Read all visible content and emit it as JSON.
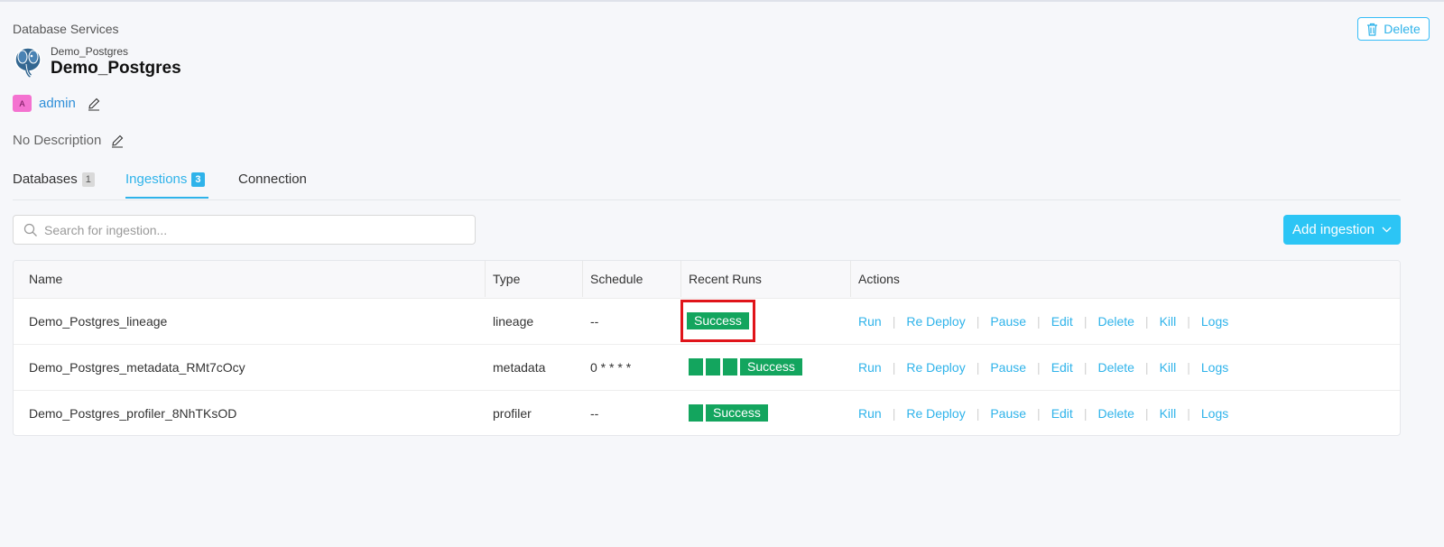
{
  "breadcrumb": "Database Services",
  "service": {
    "small_name": "Demo_Postgres",
    "title": "Demo_Postgres",
    "icon": "postgres-elephant-icon"
  },
  "delete_label": "Delete",
  "owner": {
    "avatar_letter": "A",
    "name": "admin"
  },
  "description": "No Description",
  "tabs": [
    {
      "label": "Databases",
      "count": "1"
    },
    {
      "label": "Ingestions",
      "count": "3"
    },
    {
      "label": "Connection"
    }
  ],
  "search": {
    "placeholder": "Search for ingestion..."
  },
  "add_ingestion_label": "Add ingestion",
  "table": {
    "headers": [
      "Name",
      "Type",
      "Schedule",
      "Recent Runs",
      "Actions"
    ],
    "rows": [
      {
        "name": "Demo_Postgres_lineage",
        "type": "lineage",
        "schedule": "--",
        "run_status": "Success",
        "extra_runs": 0
      },
      {
        "name": "Demo_Postgres_metadata_RMt7cOcy",
        "type": "metadata",
        "schedule": "0 * * * *",
        "run_status": "Success",
        "extra_runs": 3
      },
      {
        "name": "Demo_Postgres_profiler_8NhTKsOD",
        "type": "profiler",
        "schedule": "--",
        "run_status": "Success",
        "extra_runs": 1
      }
    ],
    "actions": [
      "Run",
      "Re Deploy",
      "Pause",
      "Edit",
      "Delete",
      "Kill",
      "Logs"
    ]
  },
  "colors": {
    "accent": "#2fb3ea",
    "success": "#13a55e",
    "highlight": "#e0141a"
  }
}
